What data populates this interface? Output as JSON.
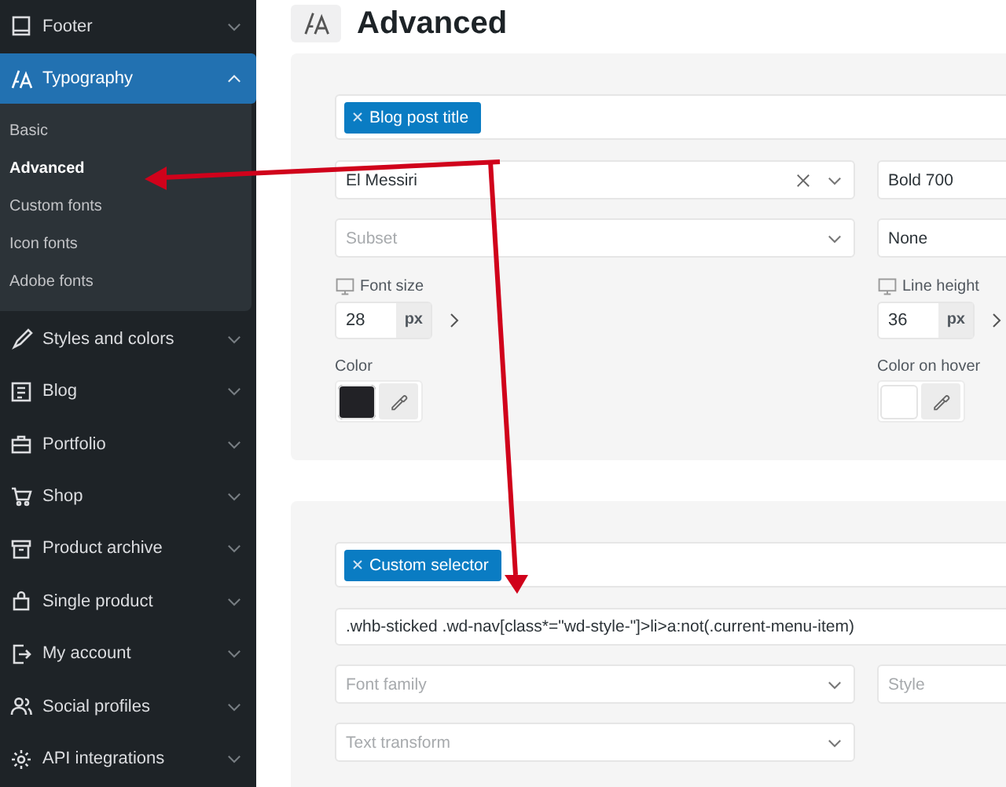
{
  "sidebar": {
    "items": [
      {
        "label": "Footer",
        "selected": false,
        "expanded": false
      },
      {
        "label": "Typography",
        "selected": true,
        "expanded": true,
        "children": [
          {
            "label": "Basic",
            "selected": false
          },
          {
            "label": "Advanced",
            "selected": true
          },
          {
            "label": "Custom fonts",
            "selected": false
          },
          {
            "label": "Icon fonts",
            "selected": false
          },
          {
            "label": "Adobe fonts",
            "selected": false
          }
        ]
      },
      {
        "label": "Styles and colors",
        "selected": false,
        "expanded": false
      },
      {
        "label": "Blog",
        "selected": false,
        "expanded": false
      },
      {
        "label": "Portfolio",
        "selected": false,
        "expanded": false
      },
      {
        "label": "Shop",
        "selected": false,
        "expanded": false
      },
      {
        "label": "Product archive",
        "selected": false,
        "expanded": false
      },
      {
        "label": "Single product",
        "selected": false,
        "expanded": false
      },
      {
        "label": "My account",
        "selected": false,
        "expanded": false
      },
      {
        "label": "Social profiles",
        "selected": false,
        "expanded": false
      },
      {
        "label": "API integrations",
        "selected": false,
        "expanded": false
      }
    ]
  },
  "page": {
    "title": "Advanced"
  },
  "panels": [
    {
      "tag": "Blog post title",
      "fields": [
        {
          "kind": "select",
          "value": "El Messiri",
          "clearable": true
        },
        {
          "kind": "select",
          "value": "Bold 700"
        },
        {
          "kind": "select",
          "placeholder": "Subset"
        },
        {
          "kind": "select",
          "value": "None"
        },
        {
          "kind": "size",
          "label": "Font size",
          "value": "28",
          "unit": "px"
        },
        {
          "kind": "size",
          "label": "Line height",
          "value": "36",
          "unit": "px"
        },
        {
          "kind": "color",
          "label": "Color",
          "color": "#222226"
        },
        {
          "kind": "color",
          "label": "Color on hover",
          "color": "#ffffff"
        }
      ]
    },
    {
      "tag": "Custom selector",
      "fields": [
        {
          "kind": "text",
          "value": ".whb-sticked .wd-nav[class*=\"wd-style-\"]>li>a:not(.current-menu-item)"
        },
        {
          "kind": "select",
          "placeholder": "Font family"
        },
        {
          "kind": "select",
          "placeholder": "Style"
        },
        {
          "kind": "select",
          "placeholder": "Text transform"
        }
      ]
    }
  ]
}
